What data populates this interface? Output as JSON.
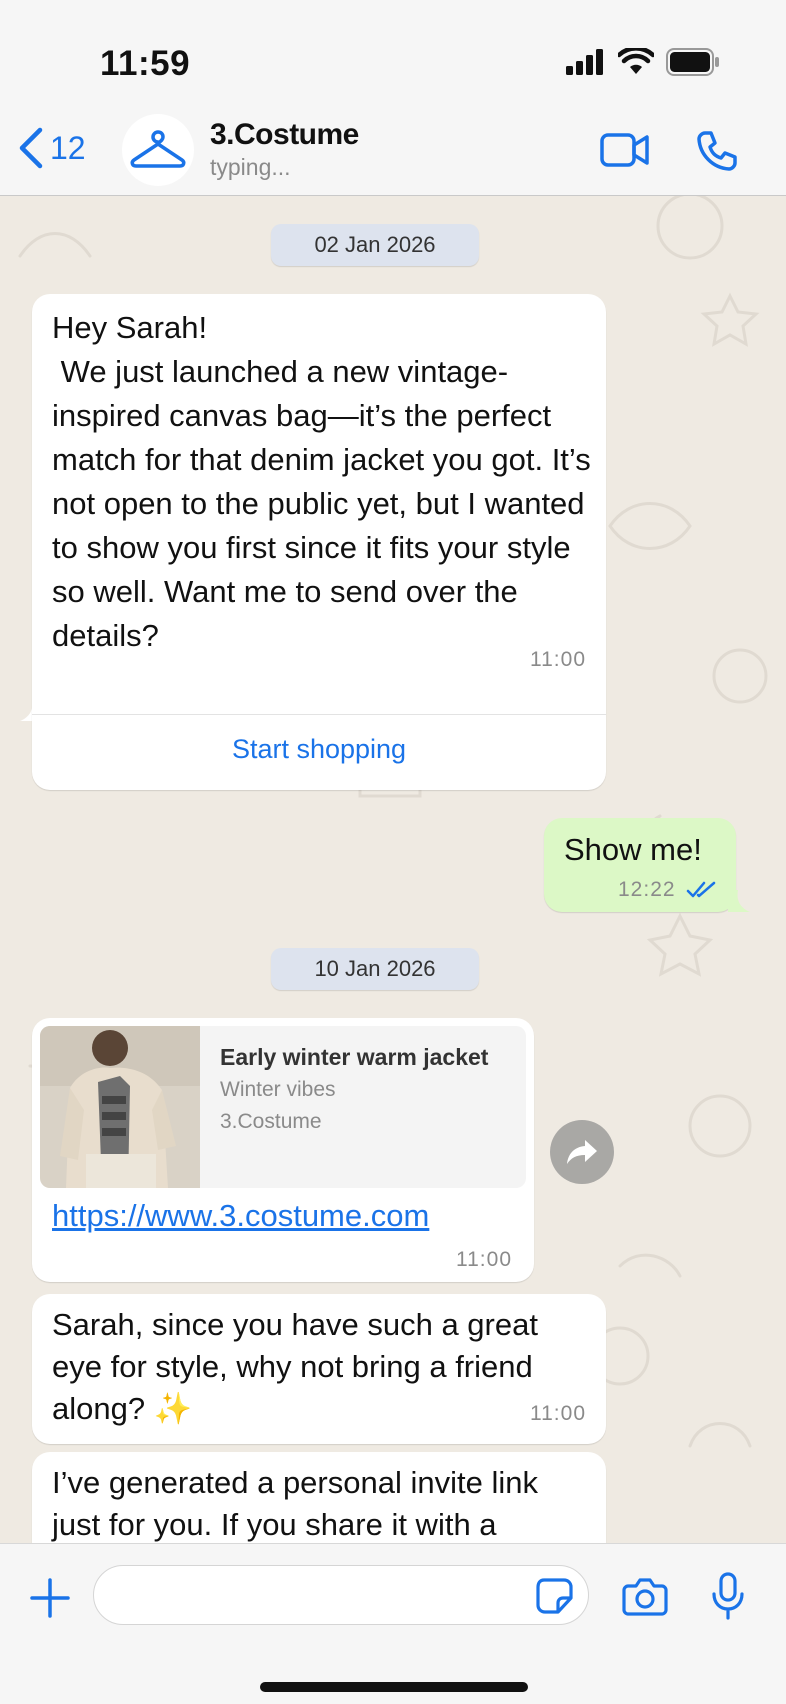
{
  "status_bar": {
    "time": "11:59"
  },
  "header": {
    "back_count": "12",
    "contact_name": "3.Costume",
    "contact_status": "typing..."
  },
  "messages": [
    {
      "type": "date",
      "label": "02 Jan 2026"
    },
    {
      "type": "incoming",
      "text": "Hey Sarah!\n We just launched a new vintage-inspired canvas bag—it’s the perfect match for that denim jacket you got. It’s not open to the public yet, but I wanted to show you first since it fits your style so well. Want me to send over the details?",
      "time": "11:00",
      "action_label": "Start shopping"
    },
    {
      "type": "outgoing",
      "text": "Show me!",
      "time": "12:22"
    },
    {
      "type": "date",
      "label": "10 Jan 2026"
    },
    {
      "type": "incoming-link",
      "preview_title": "Early winter warm jacket",
      "preview_description": "Winter vibes",
      "preview_domain": "3.Costume",
      "link": "https://www.3.costume.com",
      "time": "11:00"
    },
    {
      "type": "incoming",
      "text": "Sarah, since you have such a great eye for style, why not bring a friend along? ✨",
      "time": "11:00"
    },
    {
      "type": "incoming",
      "text": "I’ve generated a personal invite link just for you. If you share it with a"
    }
  ],
  "icons": {
    "back": "chevron-left-icon",
    "avatar": "hanger-icon",
    "video": "video-camera-icon",
    "call": "phone-icon",
    "forward": "forward-icon",
    "add": "plus-icon",
    "sticker": "sticker-icon",
    "camera": "camera-icon",
    "mic": "microphone-icon"
  },
  "colors": {
    "accent": "#1a73e8",
    "outgoing_bubble": "#dcf8c6",
    "incoming_bubble": "#ffffff",
    "chat_background": "#efeae2"
  }
}
